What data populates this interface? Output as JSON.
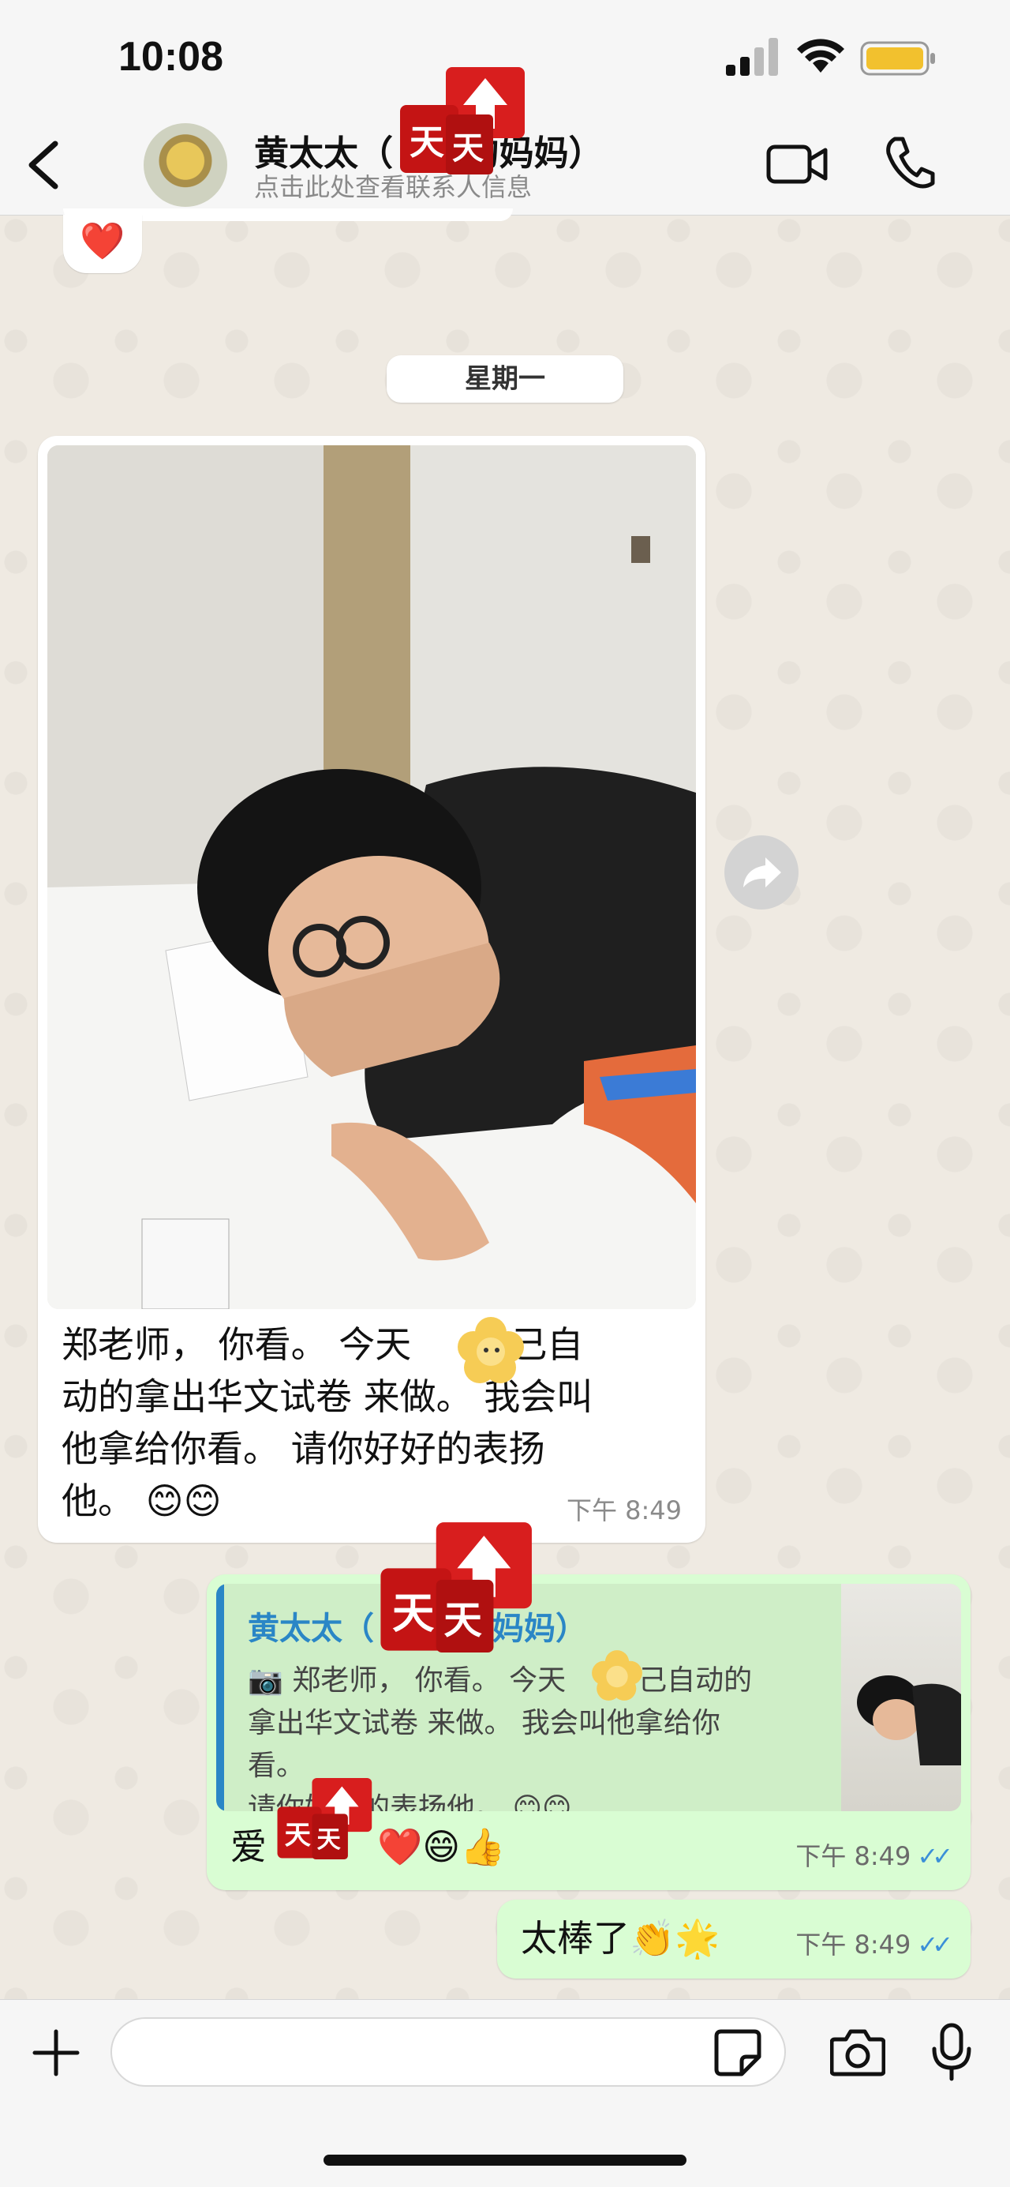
{
  "status_bar": {
    "time": "10:08"
  },
  "header": {
    "contact_name": "黄太太（",
    "contact_name_tail": "3的妈妈）",
    "contact_subtitle": "点击此处查看联系人信息",
    "avatar": "winnie-the-pooh-avatar",
    "icons": [
      "chevron-left-icon",
      "video-camera-icon",
      "phone-icon"
    ]
  },
  "messages": {
    "heart_reaction": "❤️",
    "day_divider": "星期一",
    "incoming": {
      "caption_line1_a": "郑老师， 你看。 今天",
      "caption_line1_b": "自己自",
      "caption_line2": "动的拿出华文试卷 来做。 我会叫",
      "caption_line3": "他拿给你看。 请你好好的表扬",
      "caption_line4": "他。 😊😊",
      "time": "下午 8:49"
    },
    "reply": {
      "quote_name": "黄太太（",
      "quote_name_tail": "的妈妈）",
      "quote_line1_a": "📷 郑老师， 你看。 今天",
      "quote_line1_b": "自己自动的",
      "quote_line2": "拿出华文试卷 来做。 我会叫他拿给你看。",
      "quote_line3": "请你好好的表扬他。 😊😊",
      "text_a": "爱",
      "text_b": "❤️😄👍",
      "time": "下午 8:49",
      "ticks": "✓✓"
    },
    "outgoing2": {
      "text": "太棒了👏🌟",
      "time": "下午 8:49",
      "ticks": "✓✓"
    }
  },
  "input_bar": {
    "placeholder": ""
  },
  "colors": {
    "outgoing_bubble": "#d9fdd3",
    "quote_accent": "#2a86c6",
    "read_ticks": "#3b8fd8",
    "chat_bg": "#efeae2"
  }
}
